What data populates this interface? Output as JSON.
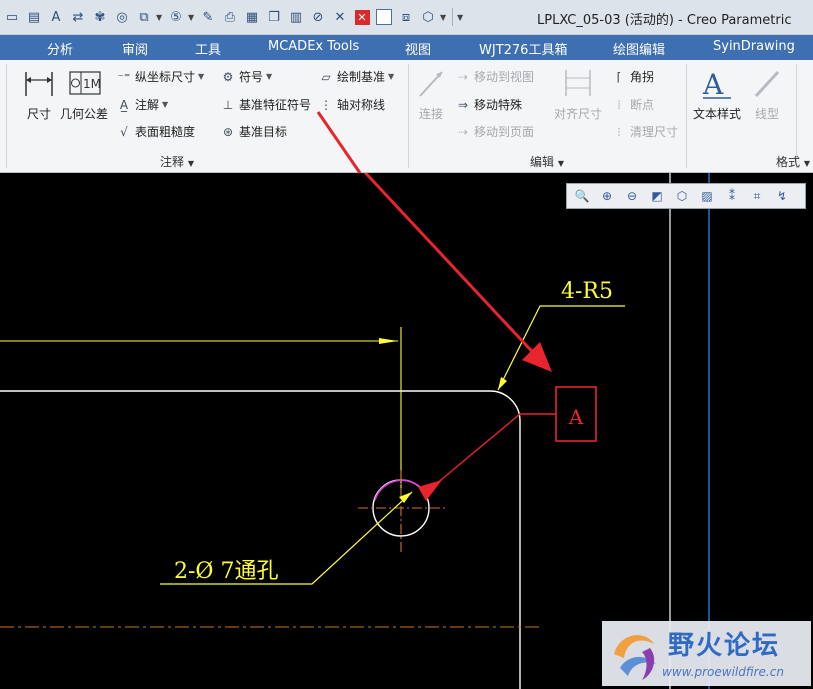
{
  "window": {
    "title": "LPLXC_05-03 (活动的) - Creo Parametric"
  },
  "quick_access": {
    "icons": [
      "new-file-icon",
      "open-file-icon",
      "text-icon",
      "regenerate-icon",
      "settings-icon",
      "target-icon",
      "window-icon",
      "number-5-icon",
      "eraser-icon",
      "print-icon",
      "print-preview-icon",
      "copy-icon",
      "table-icon",
      "no-sign-icon",
      "close-x-icon",
      "close-red-icon",
      "select-window-icon",
      "view-cube-icon"
    ]
  },
  "menu": {
    "items": [
      "分析",
      "审阅",
      "工具",
      "MCADEx Tools",
      "视图",
      "WJT276工具箱",
      "绘图编辑",
      "SyinDrawing"
    ]
  },
  "ribbon": {
    "annotation": {
      "dimension": "尺寸",
      "gtol": "几何公差",
      "ordinate_dimension": "纵坐标尺寸",
      "note": "注解",
      "surface_finish": "表面粗糙度",
      "symbol": "符号",
      "datum_feature_symbol": "基准特征符号",
      "datum_target": "基准目标",
      "draw_datum": "绘制基准",
      "axis_of_symmetry": "轴对称线",
      "group_label": "注释"
    },
    "edit": {
      "connect": "连接",
      "move_to_view": "移动到视图",
      "move_special": "移动特殊",
      "move_to_page": "移动到页面",
      "align_dimensions": "对齐尺寸",
      "angle_break": "角拐",
      "breakpoint": "断点",
      "clean_dimensions": "清理尺寸",
      "group_label": "编辑"
    },
    "format": {
      "text_style": "文本样式",
      "line_style": "线型",
      "group_label": "格式"
    }
  },
  "view_toolbar": {
    "icons": [
      "zoom-fit-icon",
      "zoom-in-icon",
      "zoom-out-icon",
      "repaint-icon",
      "view-box-icon",
      "layer-icon",
      "datum-display-icon",
      "annotation-display-icon",
      "arrow-display-icon"
    ]
  },
  "drawing": {
    "radius_note": "4-R5",
    "hole_note": "2-Ø 7通孔",
    "datum_label": "A",
    "colors": {
      "yellow": "#ffff33",
      "red": "#e8242c",
      "white": "#ffffff",
      "blue": "#3a8be8",
      "centerline": "#c87828",
      "magenta": "#e040e0"
    }
  },
  "watermark": {
    "title": "野火论坛",
    "url": "www.proewildfire.cn"
  }
}
